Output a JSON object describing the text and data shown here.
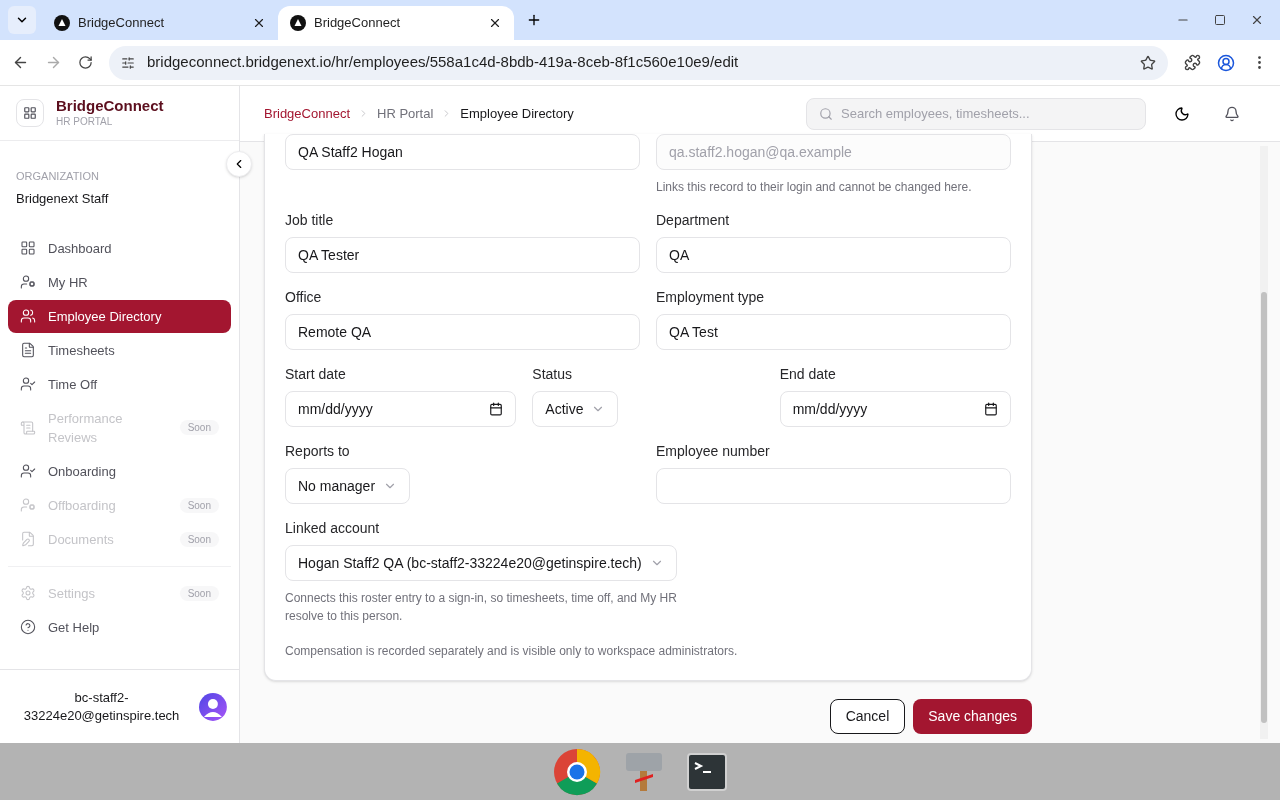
{
  "browser": {
    "tabs": [
      {
        "title": "BridgeConnect",
        "selected": false
      },
      {
        "title": "BridgeConnect",
        "selected": true
      }
    ],
    "url": "bridgeconnect.bridgenext.io/hr/employees/558a1c4d-8bdb-419a-8ceb-8f1c560e10e9/edit"
  },
  "sidebar": {
    "brand": "BridgeConnect",
    "subtitle": "HR PORTAL",
    "org_label": "ORGANIZATION",
    "org_name": "Bridgenext Staff",
    "nav_items": [
      {
        "label": "Dashboard",
        "selected": false,
        "disabled": false
      },
      {
        "label": "My HR",
        "selected": false,
        "disabled": false
      },
      {
        "label": "Employee Directory",
        "selected": true,
        "disabled": false
      },
      {
        "label": "Timesheets",
        "selected": false,
        "disabled": false
      },
      {
        "label": "Time Off",
        "selected": false,
        "disabled": false
      },
      {
        "label": "Performance Reviews",
        "selected": false,
        "disabled": true,
        "badge": "Soon"
      },
      {
        "label": "Onboarding",
        "selected": false,
        "disabled": false
      },
      {
        "label": "Offboarding",
        "selected": false,
        "disabled": true,
        "badge": "Soon"
      },
      {
        "label": "Documents",
        "selected": false,
        "disabled": true,
        "badge": "Soon"
      }
    ],
    "footer_items": [
      {
        "label": "Settings",
        "selected": false,
        "disabled": true,
        "badge": "Soon"
      },
      {
        "label": "Get Help",
        "selected": false,
        "disabled": false
      }
    ],
    "user": "bc-staff2-33224e20@getinspire.tech"
  },
  "header": {
    "breadcrumbs": [
      "BridgeConnect",
      "HR Portal",
      "Employee Directory"
    ],
    "search_placeholder": "Search employees, timesheets..."
  },
  "form": {
    "rows": [
      {
        "kind": "pair",
        "fields": [
          {
            "kind": "text",
            "value": "QA Staff2 Hogan"
          },
          {
            "kind": "text",
            "value": "qa.staff2.hogan@qa.example",
            "disabled": true,
            "hint": "Links this record to their login and cannot be changed here."
          }
        ]
      },
      {
        "kind": "pair",
        "fields": [
          {
            "kind": "text",
            "label": "Job title",
            "value": "QA Tester"
          },
          {
            "kind": "text",
            "label": "Department",
            "value": "QA"
          }
        ]
      },
      {
        "kind": "pair",
        "fields": [
          {
            "kind": "text",
            "label": "Office",
            "value": "Remote QA"
          },
          {
            "kind": "text",
            "label": "Employment type",
            "value": "QA Test"
          }
        ]
      },
      {
        "kind": "triple",
        "fields": [
          {
            "kind": "date",
            "label": "Start date",
            "placeholder": "mm/dd/yyyy"
          },
          {
            "kind": "select",
            "label": "Status",
            "value": "Active"
          },
          {
            "kind": "date",
            "label": "End date",
            "placeholder": "mm/dd/yyyy"
          }
        ]
      },
      {
        "kind": "pair",
        "fields": [
          {
            "kind": "select",
            "label": "Reports to",
            "value": "No manager"
          },
          {
            "kind": "text",
            "label": "Employee number"
          }
        ]
      },
      {
        "kind": "wide",
        "fields": [
          {
            "kind": "select",
            "label": "Linked account",
            "value": "Hogan Staff2 QA (bc-staff2-33224e20@getinspire.tech)",
            "hint": "Connects this roster entry to a sign-in, so timesheets, time off, and My HR resolve to this person."
          }
        ]
      }
    ],
    "note": "Compensation is recorded separately and is visible only to workspace administrators.",
    "buttons": [
      {
        "label": "Cancel",
        "kind": "secondary"
      },
      {
        "label": "Save changes",
        "kind": "primary"
      }
    ]
  }
}
